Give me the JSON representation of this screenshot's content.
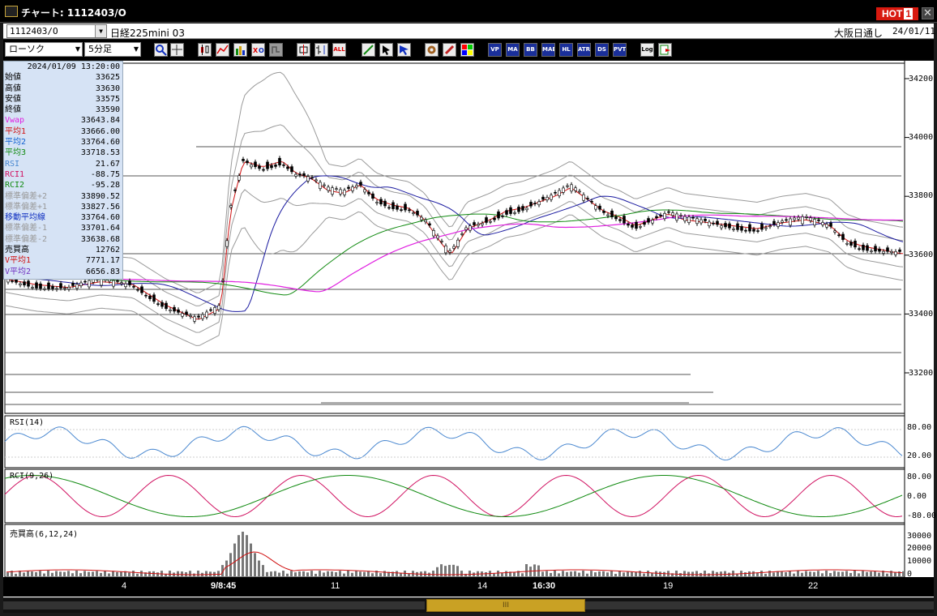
{
  "window": {
    "title": "チャート: 1112403/O",
    "hot_label": "HOT",
    "hot_num": "1",
    "close": "✕"
  },
  "symbolbar": {
    "symbol_value": "1112403/O",
    "symbol_name": "日経225mini 03",
    "session": "大阪日通し",
    "date": "24/01/11"
  },
  "toolbar": {
    "chart_type": "ローソク",
    "interval": "5分足",
    "buttons": [
      "zoom",
      "cursor",
      "candle",
      "tick",
      "bar",
      "pnf",
      "kagi",
      "box",
      "bar2",
      "all",
      "draw",
      "pointer",
      "arrow",
      "settings",
      "pen",
      "palette",
      "vp",
      "ma",
      "bb",
      "mae",
      "hl",
      "atr",
      "ds",
      "pvt",
      "log",
      "export"
    ],
    "button_labels": {
      "all": "ALL",
      "vp": "VP",
      "ma": "MA",
      "bb": "BB",
      "mae": "MAE",
      "hl": "HL",
      "atr": "ATR",
      "ds": "DS",
      "pvt": "PVT",
      "log": "Log"
    }
  },
  "info": {
    "datetime": "2024/01/09  13:20:00",
    "rows": [
      {
        "label": "始値",
        "value": "33625",
        "color": "#000000"
      },
      {
        "label": "高値",
        "value": "33630",
        "color": "#000000"
      },
      {
        "label": "安値",
        "value": "33575",
        "color": "#000000"
      },
      {
        "label": "終値",
        "value": "33590",
        "color": "#000000"
      },
      {
        "label": "Vwap",
        "value": "33643.84",
        "color": "#e020e0"
      },
      {
        "label": "平均1",
        "value": "33666.00",
        "color": "#d01010"
      },
      {
        "label": "平均2",
        "value": "33764.60",
        "color": "#1060d0"
      },
      {
        "label": "平均3",
        "value": "33718.53",
        "color": "#108a10"
      },
      {
        "label": "RSI",
        "value": "21.67",
        "color": "#4a88d0"
      },
      {
        "label": "RCI1",
        "value": "-88.75",
        "color": "#d01060"
      },
      {
        "label": "RCI2",
        "value": "-95.28",
        "color": "#108a10"
      },
      {
        "label": "標準偏差+2",
        "value": "33890.52",
        "color": "#999999"
      },
      {
        "label": "標準偏差+1",
        "value": "33827.56",
        "color": "#999999"
      },
      {
        "label": "移動平均線",
        "value": "33764.60",
        "color": "#1030c0"
      },
      {
        "label": "標準偏差-1",
        "value": "33701.64",
        "color": "#999999"
      },
      {
        "label": "標準偏差-2",
        "value": "33638.68",
        "color": "#999999"
      },
      {
        "label": "売買高",
        "value": "12762",
        "color": "#000000"
      },
      {
        "label": "V平均1",
        "value": "7771.17",
        "color": "#d01010"
      },
      {
        "label": "V平均2",
        "value": "6656.83",
        "color": "#7030c0"
      }
    ]
  },
  "panels": {
    "rsi_label": "RSI(14)",
    "rci_label": "RCI(9,26)",
    "vol_label": "売買高(6,12,24)",
    "rsi_ticks": [
      "80.00",
      "20.00"
    ],
    "rci_ticks": [
      "80.00",
      "0.00",
      "-80.00"
    ],
    "vol_ticks": [
      "30000",
      "20000",
      "10000",
      "0"
    ]
  },
  "price_axis": {
    "ticks": [
      "34200",
      "34000",
      "33800",
      "33600",
      "33400",
      "33200"
    ]
  },
  "x_axis": {
    "labels": [
      "4",
      "9/8:45",
      "11",
      "14",
      "16:30",
      "19",
      "22"
    ]
  },
  "colors": {
    "close_ma1": "#d01010",
    "ma2": "#1a1aa0",
    "ma3": "#108a10",
    "vwap": "#e020e0",
    "band": "#9a9a9a",
    "rsi": "#4a88d0",
    "rci1": "#d01060",
    "rci2": "#108a10"
  },
  "scrollbar": {
    "thumb_label": "III"
  }
}
